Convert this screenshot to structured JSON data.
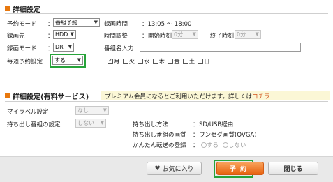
{
  "section1": {
    "title": "詳細設定",
    "reservation_mode": {
      "label": "予約モード",
      "value": "番組予約"
    },
    "recording_time": {
      "label": "録画時間",
      "value": "：13:05 ～ 18:00"
    },
    "recording_dest": {
      "label": "録画先",
      "value": "HDD"
    },
    "time_adjust": {
      "label": "時間調整",
      "start_label": "開始時刻",
      "start_value": "0分",
      "end_label": "終了時刻",
      "end_value": "0分"
    },
    "recording_mode": {
      "label": "録画モード",
      "value": "DR"
    },
    "program_name_input": {
      "label": "番組名入力",
      "value": ""
    },
    "weekly": {
      "label": "毎週予約設定",
      "value": "する"
    },
    "days": [
      {
        "label": "月",
        "checked": true
      },
      {
        "label": "火",
        "checked": false
      },
      {
        "label": "水",
        "checked": false
      },
      {
        "label": "木",
        "checked": false
      },
      {
        "label": "金",
        "checked": false
      },
      {
        "label": "土",
        "checked": false
      },
      {
        "label": "日",
        "checked": false
      }
    ],
    "colon": "："
  },
  "section2": {
    "title": "詳細設定(有料サービス)",
    "premium_notice": "プレミアム会員になるとご利用いただけます。詳しくは",
    "premium_link": "コチラ",
    "my_label": {
      "label": "マイラベル設定",
      "value": "なし"
    },
    "takeout_setting": {
      "label": "持ち出し番組の設定",
      "value": "しない"
    },
    "takeout_method": {
      "label": "持ち出し方法",
      "value": "SD/USB経由"
    },
    "takeout_quality": {
      "label": "持ち出し番組の画質",
      "value": "ワンセグ画質(QVGA)"
    },
    "easy_transfer": {
      "label": "かんたん転送の登録",
      "option_yes": "する",
      "option_no": "しない"
    }
  },
  "footer": {
    "favorite_label": "お気に入り",
    "reserve_label": "予約",
    "close_label": "閉じる"
  },
  "colors": {
    "accent": "#e8780e",
    "highlight": "#27a33a",
    "link": "#d2541b",
    "premium_bg": "#fbf7d6"
  }
}
